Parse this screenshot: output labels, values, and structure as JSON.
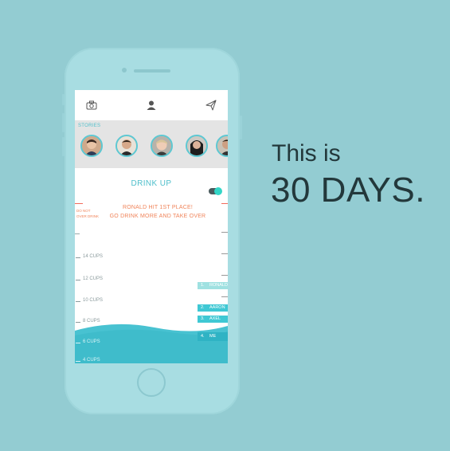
{
  "headline": {
    "line1": "This is",
    "line2": "30 DAYS."
  },
  "colors": {
    "background": "#93ccd2",
    "accent": "#4fbfcb",
    "message": "#f0845a",
    "toggle_on": "#33d6c7"
  },
  "topbar": {
    "icons": [
      "camera-icon",
      "profile-icon",
      "send-icon"
    ]
  },
  "stories": {
    "label": "STORIES",
    "avatars": [
      "avatar-1",
      "avatar-2",
      "avatar-3",
      "avatar-4",
      "avatar-5"
    ]
  },
  "main": {
    "title": "DRINK UP",
    "warning": "DO NOT OVER DRINK",
    "message_line1": "RONALD HIT 1ST PLACE!",
    "message_line2": "GO DRINK MORE AND TAKE OVER",
    "toggle_on": true
  },
  "cups": [
    "14 CUPS",
    "12 CUPS",
    "10 CUPS",
    "8 CUPS",
    "6 CUPS",
    "4 CUPS"
  ],
  "leaderboard": [
    {
      "rank": "1.",
      "name": "RONALD"
    },
    {
      "rank": "2.",
      "name": "AARON"
    },
    {
      "rank": "3.",
      "name": "AXEL"
    },
    {
      "rank": "4.",
      "name": "ME"
    }
  ]
}
